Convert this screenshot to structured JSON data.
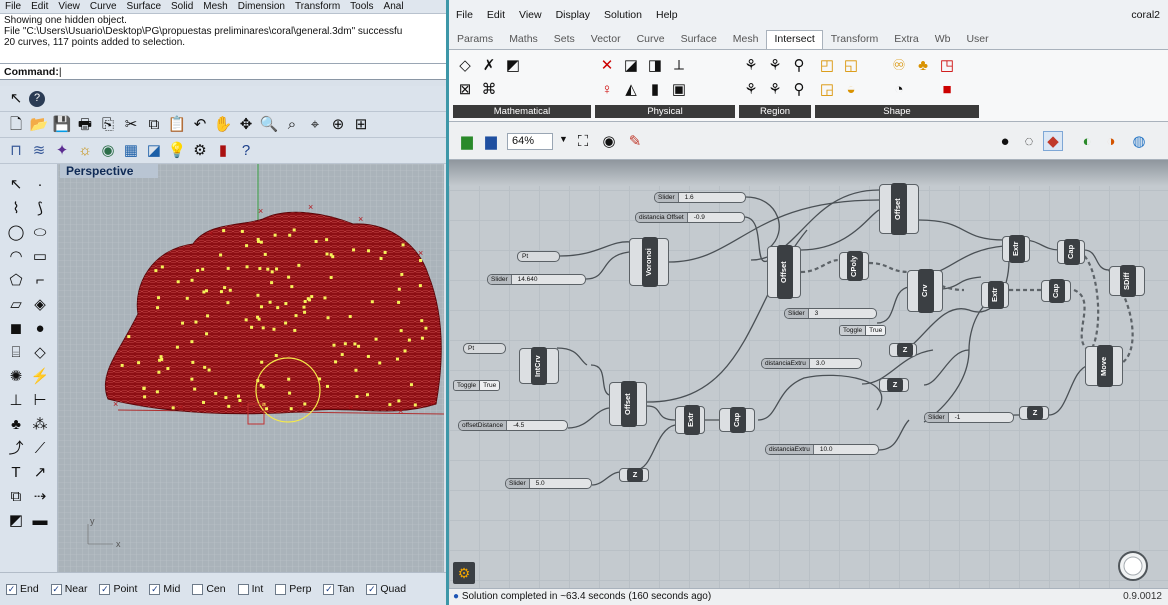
{
  "rhino": {
    "menu": [
      "File",
      "Edit",
      "View",
      "Curve",
      "Surface",
      "Solid",
      "Mesh",
      "Dimension",
      "Transform",
      "Tools",
      "Anal"
    ],
    "history": [
      "Showing one hidden object.",
      "File \"C:\\Users\\Usuario\\Desktop\\PG\\propuestas preliminares\\coral\\general.3dm\" successfu",
      "20 curves, 117 points added to selection."
    ],
    "command_label": "Command:",
    "viewport_title": "Perspective",
    "axis_x": "x",
    "axis_y": "y",
    "osnaps": [
      {
        "label": "End",
        "checked": true
      },
      {
        "label": "Near",
        "checked": true
      },
      {
        "label": "Point",
        "checked": true
      },
      {
        "label": "Mid",
        "checked": true
      },
      {
        "label": "Cen",
        "checked": false
      },
      {
        "label": "Int",
        "checked": false
      },
      {
        "label": "Perp",
        "checked": false
      },
      {
        "label": "Tan",
        "checked": true
      },
      {
        "label": "Quad",
        "checked": true
      }
    ]
  },
  "gh": {
    "menu": [
      "File",
      "Edit",
      "View",
      "Display",
      "Solution",
      "Help"
    ],
    "document": "coral2",
    "tabs": [
      "Params",
      "Maths",
      "Sets",
      "Vector",
      "Curve",
      "Surface",
      "Mesh",
      "Intersect",
      "Transform",
      "Extra",
      "Wb",
      "User"
    ],
    "active_tab": "Intersect",
    "ribbon_groups": [
      "Mathematical",
      "Physical",
      "Region",
      "Shape"
    ],
    "zoom": "64%",
    "status": "Solution completed in ~63.4 seconds (160 seconds ago)",
    "version": "0.9.0012",
    "nodes": {
      "voronoi": "Voronoi",
      "offset": "Offset",
      "cpoly": "CPoly",
      "crv": "Crv",
      "intcrv": "IntCrv",
      "extr": "Extr",
      "cap": "Cap",
      "sdiff": "SDiff",
      "move": "Move",
      "z": "Z"
    },
    "sliders": {
      "s1_label": "Slider",
      "s1_value": "1.6",
      "s2_label": "distancia Offset",
      "s2_value": "-0.9",
      "s3_label": "Slider",
      "s3_value": "14.640",
      "s4_label": "Slider",
      "s4_value": "3",
      "s5_label": "distanciaExtru",
      "s5_value": "3.0",
      "s6_label": "offsetDistance",
      "s6_value": "-4.5",
      "s7_label": "Slider",
      "s7_value": "-1",
      "s8_label": "distanciaExtru",
      "s8_value": "10.0",
      "s9_label": "Slider",
      "s9_value": "5.0"
    },
    "pt1": "Pt",
    "pt2": "Pt",
    "toggle1": {
      "label": "Toggle",
      "value": "True"
    },
    "toggle2": {
      "label": "Toggle",
      "value": "True"
    }
  }
}
